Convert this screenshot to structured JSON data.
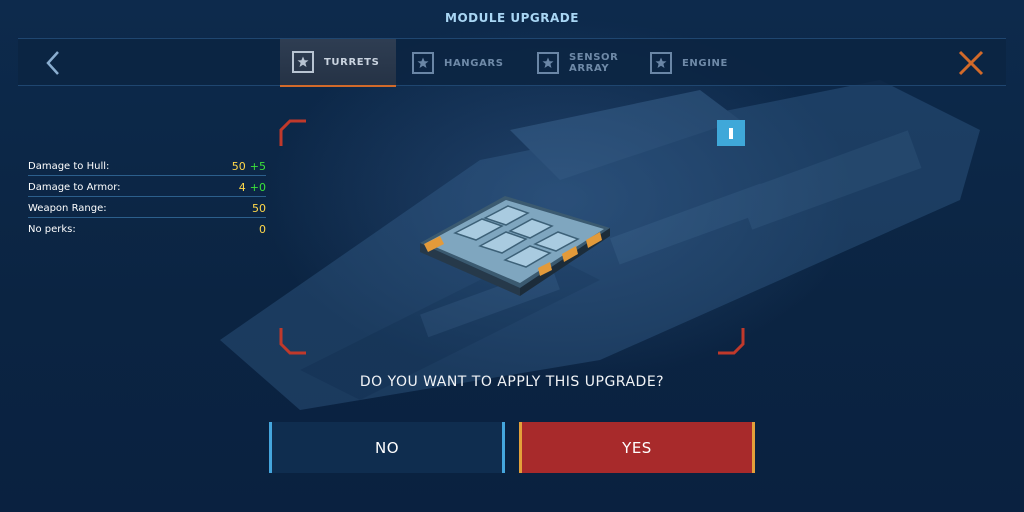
{
  "header": {
    "title": "MODULE UPGRADE"
  },
  "tabs": [
    {
      "label": "TURRETS",
      "active": true,
      "icon": "star-icon"
    },
    {
      "label": "HANGARS",
      "active": false,
      "icon": "star-icon"
    },
    {
      "label": "SENSOR\nARRAY",
      "active": false,
      "icon": "star-icon"
    },
    {
      "label": "ENGINE",
      "active": false,
      "icon": "star-icon"
    }
  ],
  "nav": {
    "back_icon": "chevron-left-icon",
    "close_icon": "close-icon"
  },
  "stats": [
    {
      "label": "Damage to Hull:",
      "value": "50",
      "bonus": "+5"
    },
    {
      "label": "Damage to Armor:",
      "value": "4",
      "bonus": "+0"
    },
    {
      "label": "Weapon Range:",
      "value": "50",
      "bonus": ""
    },
    {
      "label": "No perks:",
      "value": "0",
      "bonus": ""
    }
  ],
  "dialog": {
    "question": "DO YOU WANT TO APPLY THIS UPGRADE?",
    "no_label": "NO",
    "yes_label": "YES"
  },
  "colors": {
    "accent_orange": "#d26a2a",
    "info_blue": "#3fa8d9",
    "yes_red": "#a82a2b",
    "value_yellow": "#ffd84a",
    "bonus_green": "#3be23a"
  }
}
